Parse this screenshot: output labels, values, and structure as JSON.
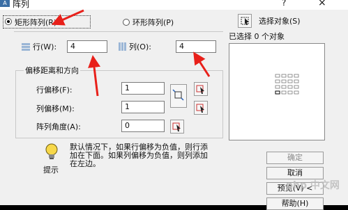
{
  "window": {
    "title": "阵列",
    "icon_text": "A",
    "help": "?",
    "close": "×"
  },
  "mode": {
    "rect_label": "矩形阵列(R)",
    "polar_label": "环形阵列(P)",
    "selected": "rect"
  },
  "select_objects": {
    "label": "选择对象(S)",
    "status": "已选择 0 个对象"
  },
  "rows": {
    "label": "行(W):",
    "value": "4"
  },
  "columns": {
    "label": "列(O):",
    "value": "4"
  },
  "offset": {
    "title": "偏移距离和方向",
    "row_offset_label": "行偏移(F):",
    "row_offset_value": "1",
    "col_offset_label": "列偏移(M):",
    "col_offset_value": "1",
    "angle_label": "阵列角度(A):",
    "angle_value": "0"
  },
  "tip": {
    "title": "提示",
    "text": "默认情况下，如果行偏移为负值，则行添加在下面。如果列偏移为负值，则列添加在左边。"
  },
  "buttons": {
    "ok": "确定",
    "cancel": "取消",
    "preview": "预览(V) <",
    "help": "帮助(H)"
  },
  "watermark": "php 中文网",
  "colors": {
    "arrow": "#e8201a",
    "dialog_bg": "#f0f0f0"
  }
}
